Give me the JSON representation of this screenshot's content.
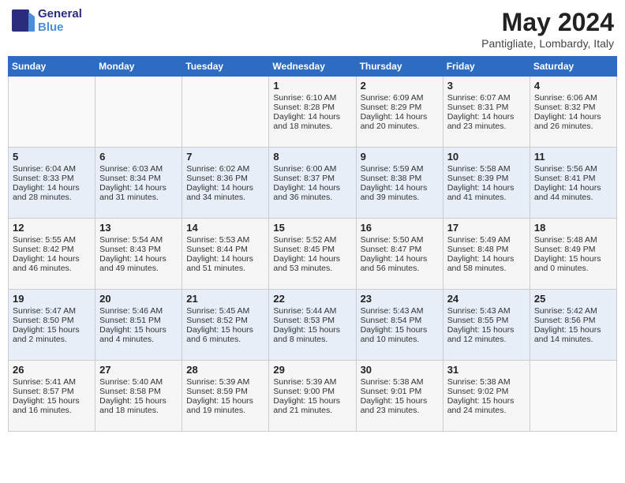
{
  "header": {
    "logo": "GeneralBlue",
    "title": "May 2024",
    "location": "Pantigliate, Lombardy, Italy"
  },
  "weekdays": [
    "Sunday",
    "Monday",
    "Tuesday",
    "Wednesday",
    "Thursday",
    "Friday",
    "Saturday"
  ],
  "weeks": [
    [
      {
        "day": "",
        "info": ""
      },
      {
        "day": "",
        "info": ""
      },
      {
        "day": "",
        "info": ""
      },
      {
        "day": "1",
        "info": "Sunrise: 6:10 AM\nSunset: 8:28 PM\nDaylight: 14 hours and 18 minutes."
      },
      {
        "day": "2",
        "info": "Sunrise: 6:09 AM\nSunset: 8:29 PM\nDaylight: 14 hours and 20 minutes."
      },
      {
        "day": "3",
        "info": "Sunrise: 6:07 AM\nSunset: 8:31 PM\nDaylight: 14 hours and 23 minutes."
      },
      {
        "day": "4",
        "info": "Sunrise: 6:06 AM\nSunset: 8:32 PM\nDaylight: 14 hours and 26 minutes."
      }
    ],
    [
      {
        "day": "5",
        "info": "Sunrise: 6:04 AM\nSunset: 8:33 PM\nDaylight: 14 hours and 28 minutes."
      },
      {
        "day": "6",
        "info": "Sunrise: 6:03 AM\nSunset: 8:34 PM\nDaylight: 14 hours and 31 minutes."
      },
      {
        "day": "7",
        "info": "Sunrise: 6:02 AM\nSunset: 8:36 PM\nDaylight: 14 hours and 34 minutes."
      },
      {
        "day": "8",
        "info": "Sunrise: 6:00 AM\nSunset: 8:37 PM\nDaylight: 14 hours and 36 minutes."
      },
      {
        "day": "9",
        "info": "Sunrise: 5:59 AM\nSunset: 8:38 PM\nDaylight: 14 hours and 39 minutes."
      },
      {
        "day": "10",
        "info": "Sunrise: 5:58 AM\nSunset: 8:39 PM\nDaylight: 14 hours and 41 minutes."
      },
      {
        "day": "11",
        "info": "Sunrise: 5:56 AM\nSunset: 8:41 PM\nDaylight: 14 hours and 44 minutes."
      }
    ],
    [
      {
        "day": "12",
        "info": "Sunrise: 5:55 AM\nSunset: 8:42 PM\nDaylight: 14 hours and 46 minutes."
      },
      {
        "day": "13",
        "info": "Sunrise: 5:54 AM\nSunset: 8:43 PM\nDaylight: 14 hours and 49 minutes."
      },
      {
        "day": "14",
        "info": "Sunrise: 5:53 AM\nSunset: 8:44 PM\nDaylight: 14 hours and 51 minutes."
      },
      {
        "day": "15",
        "info": "Sunrise: 5:52 AM\nSunset: 8:45 PM\nDaylight: 14 hours and 53 minutes."
      },
      {
        "day": "16",
        "info": "Sunrise: 5:50 AM\nSunset: 8:47 PM\nDaylight: 14 hours and 56 minutes."
      },
      {
        "day": "17",
        "info": "Sunrise: 5:49 AM\nSunset: 8:48 PM\nDaylight: 14 hours and 58 minutes."
      },
      {
        "day": "18",
        "info": "Sunrise: 5:48 AM\nSunset: 8:49 PM\nDaylight: 15 hours and 0 minutes."
      }
    ],
    [
      {
        "day": "19",
        "info": "Sunrise: 5:47 AM\nSunset: 8:50 PM\nDaylight: 15 hours and 2 minutes."
      },
      {
        "day": "20",
        "info": "Sunrise: 5:46 AM\nSunset: 8:51 PM\nDaylight: 15 hours and 4 minutes."
      },
      {
        "day": "21",
        "info": "Sunrise: 5:45 AM\nSunset: 8:52 PM\nDaylight: 15 hours and 6 minutes."
      },
      {
        "day": "22",
        "info": "Sunrise: 5:44 AM\nSunset: 8:53 PM\nDaylight: 15 hours and 8 minutes."
      },
      {
        "day": "23",
        "info": "Sunrise: 5:43 AM\nSunset: 8:54 PM\nDaylight: 15 hours and 10 minutes."
      },
      {
        "day": "24",
        "info": "Sunrise: 5:43 AM\nSunset: 8:55 PM\nDaylight: 15 hours and 12 minutes."
      },
      {
        "day": "25",
        "info": "Sunrise: 5:42 AM\nSunset: 8:56 PM\nDaylight: 15 hours and 14 minutes."
      }
    ],
    [
      {
        "day": "26",
        "info": "Sunrise: 5:41 AM\nSunset: 8:57 PM\nDaylight: 15 hours and 16 minutes."
      },
      {
        "day": "27",
        "info": "Sunrise: 5:40 AM\nSunset: 8:58 PM\nDaylight: 15 hours and 18 minutes."
      },
      {
        "day": "28",
        "info": "Sunrise: 5:39 AM\nSunset: 8:59 PM\nDaylight: 15 hours and 19 minutes."
      },
      {
        "day": "29",
        "info": "Sunrise: 5:39 AM\nSunset: 9:00 PM\nDaylight: 15 hours and 21 minutes."
      },
      {
        "day": "30",
        "info": "Sunrise: 5:38 AM\nSunset: 9:01 PM\nDaylight: 15 hours and 23 minutes."
      },
      {
        "day": "31",
        "info": "Sunrise: 5:38 AM\nSunset: 9:02 PM\nDaylight: 15 hours and 24 minutes."
      },
      {
        "day": "",
        "info": ""
      }
    ]
  ]
}
